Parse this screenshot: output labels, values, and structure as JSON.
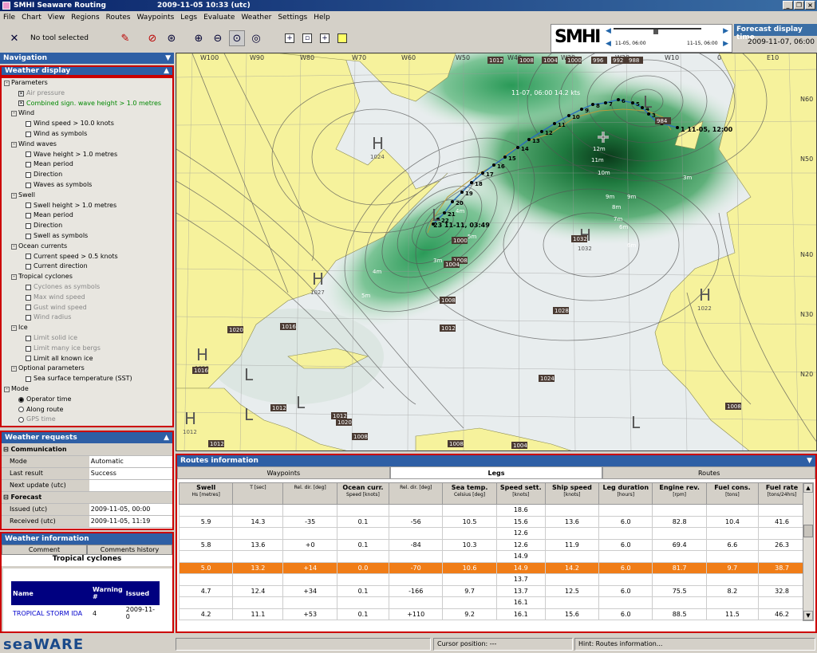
{
  "window": {
    "title": "SMHI Seaware Routing",
    "datetime": "2009-11-05   10:33 (utc)"
  },
  "menu": [
    "File",
    "Chart",
    "View",
    "Regions",
    "Routes",
    "Waypoints",
    "Legs",
    "Evaluate",
    "Weather",
    "Settings",
    "Help"
  ],
  "toolbar": {
    "tool_label": "No tool selected"
  },
  "smhi": {
    "logo": "SMHI",
    "t_left": "11-05, 06:00",
    "t_right": "11-15, 06:00"
  },
  "forecast": {
    "header": "Forecast display time",
    "value": "2009-11-07, 06:00"
  },
  "navigation": {
    "label": "Navigation"
  },
  "weather_display": {
    "label": "Weather display",
    "items": [
      {
        "t": "Parameters",
        "lvl": 0,
        "ex": "-"
      },
      {
        "t": "Air pressure",
        "lvl": 2,
        "cb": "x",
        "cls": "gray"
      },
      {
        "t": "Combined sign. wave height > 1.0 metres",
        "lvl": 2,
        "cb": "x",
        "cls": "green"
      },
      {
        "t": "Wind",
        "lvl": 1,
        "ex": "-"
      },
      {
        "t": "Wind speed > 10.0 knots",
        "lvl": 3,
        "cb": " "
      },
      {
        "t": "Wind as symbols",
        "lvl": 3,
        "cb": " "
      },
      {
        "t": "Wind waves",
        "lvl": 1,
        "ex": "-"
      },
      {
        "t": "Wave height > 1.0 metres",
        "lvl": 3,
        "cb": " "
      },
      {
        "t": "Mean period",
        "lvl": 3,
        "cb": " "
      },
      {
        "t": "Direction",
        "lvl": 3,
        "cb": " "
      },
      {
        "t": "Waves as symbols",
        "lvl": 3,
        "cb": " "
      },
      {
        "t": "Swell",
        "lvl": 1,
        "ex": "-"
      },
      {
        "t": "Swell height > 1.0 metres",
        "lvl": 3,
        "cb": " "
      },
      {
        "t": "Mean period",
        "lvl": 3,
        "cb": " "
      },
      {
        "t": "Direction",
        "lvl": 3,
        "cb": " "
      },
      {
        "t": "Swell as symbols",
        "lvl": 3,
        "cb": " "
      },
      {
        "t": "Ocean currents",
        "lvl": 1,
        "ex": "-"
      },
      {
        "t": "Current speed > 0.5 knots",
        "lvl": 3,
        "cb": " "
      },
      {
        "t": "Current direction",
        "lvl": 3,
        "cb": " "
      },
      {
        "t": "Tropical cyclones",
        "lvl": 1,
        "ex": "-"
      },
      {
        "t": "Cyclones as symbols",
        "lvl": 3,
        "cb": " ",
        "cls": "gray"
      },
      {
        "t": "Max wind speed",
        "lvl": 3,
        "cb": " ",
        "cls": "gray"
      },
      {
        "t": "Gust wind speed",
        "lvl": 3,
        "cb": " ",
        "cls": "gray"
      },
      {
        "t": "Wind radius",
        "lvl": 3,
        "cb": " ",
        "cls": "gray"
      },
      {
        "t": "Ice",
        "lvl": 1,
        "ex": "-"
      },
      {
        "t": "Limit solid ice",
        "lvl": 3,
        "cb": " ",
        "cls": "gray"
      },
      {
        "t": "Limit many ice bergs",
        "lvl": 3,
        "cb": " ",
        "cls": "gray"
      },
      {
        "t": "Limit all known ice",
        "lvl": 3,
        "cb": " "
      },
      {
        "t": "Optional parameters",
        "lvl": 1,
        "ex": "-"
      },
      {
        "t": "Sea surface temperature (SST)",
        "lvl": 3,
        "cb": " "
      },
      {
        "t": "Mode",
        "lvl": 0,
        "ex": "-"
      },
      {
        "t": "Operator time",
        "lvl": 2,
        "rb": "on"
      },
      {
        "t": "Along route",
        "lvl": 2,
        "rb": "off"
      },
      {
        "t": "GPS time",
        "lvl": 2,
        "rb": "off",
        "cls": "gray"
      }
    ]
  },
  "weather_requests": {
    "label": "Weather requests",
    "rows": [
      {
        "g": "Communication"
      },
      {
        "k": "Mode",
        "v": "Automatic"
      },
      {
        "k": "Last result",
        "v": "Success"
      },
      {
        "k": "Next update (utc)",
        "v": ""
      },
      {
        "g": "Forecast"
      },
      {
        "k": "Issued (utc)",
        "v": "2009-11-05, 00:00"
      },
      {
        "k": "Received (utc)",
        "v": "2009-11-05, 11:19"
      }
    ]
  },
  "weather_information": {
    "label": "Weather information",
    "tab_comment": "Comment",
    "tab_history": "Comments history",
    "title": "Tropical cyclones",
    "col_name": "Name",
    "col_warning": "Warning #",
    "col_issued": "Issued",
    "row_name": "TROPICAL STORM IDA",
    "row_warning": "4",
    "row_issued": "2009-11-0"
  },
  "map": {
    "lon_labels": [
      "W100",
      "W90",
      "W80",
      "W70",
      "W60",
      "W50",
      "W40",
      "W30",
      "W20",
      "W10",
      "0",
      "E10"
    ],
    "lat_labels": [
      "N60",
      "N50",
      "N40",
      "N30",
      "N20"
    ],
    "high_labels": [
      {
        "t": "H",
        "v": "1024"
      },
      {
        "t": "H",
        "v": "1032"
      },
      {
        "t": "H",
        "v": "1027"
      },
      {
        "t": "H",
        "v": "1020"
      },
      {
        "t": "H",
        "v": "1022"
      },
      {
        "t": "H",
        "v": "1012"
      }
    ],
    "low_labels": [
      "L",
      "L",
      "L",
      "L",
      "L",
      "L"
    ],
    "isobar_boxes": [
      "1012",
      "1008",
      "1004",
      "1000",
      "996",
      "992",
      "988",
      "984",
      "1008",
      "1000",
      "1004",
      "1008",
      "1012",
      "1016",
      "1020",
      "1024",
      "1028",
      "1032",
      "1008",
      "1012",
      "1016",
      "1020",
      "1012",
      "1008",
      "1004",
      "1012",
      "1008"
    ],
    "wave_labels": [
      "12m",
      "11m",
      "10m",
      "9m",
      "9m",
      "8m",
      "7m",
      "6m",
      "5m",
      "4m",
      "3m",
      "4m",
      "5m",
      "6m",
      "3m"
    ],
    "route_label_start": "1  11-05, 12:00",
    "route_label_end": "23  11-11, 03:49",
    "route_label_now": "11-07, 06:00  14.2 kts",
    "waypoints": [
      "2",
      "3",
      "4",
      "5",
      "6",
      "7",
      "8",
      "9",
      "10",
      "11",
      "12",
      "13",
      "14",
      "15",
      "16",
      "17",
      "18",
      "19",
      "20",
      "21",
      "22"
    ]
  },
  "routes": {
    "label": "Routes information",
    "tab_waypoints": "Waypoints",
    "tab_legs": "Legs",
    "tab_routes": "Routes",
    "columns": [
      {
        "t": "Swell",
        "s": "Hs [metres]"
      },
      {
        "t": "",
        "s": "T [sec]"
      },
      {
        "t": "",
        "s": "Rel. dir. [deg]"
      },
      {
        "t": "Ocean curr.",
        "s": "Speed [knots]"
      },
      {
        "t": "",
        "s": "Rel. dir. [deg]"
      },
      {
        "t": "Sea temp.",
        "s": "Celsius [deg]"
      },
      {
        "t": "Speed sett.",
        "s": "[knots]"
      },
      {
        "t": "Ship speed",
        "s": "[knots]"
      },
      {
        "t": "Leg duration",
        "s": "[hours]"
      },
      {
        "t": "Engine rev.",
        "s": "[rpm]"
      },
      {
        "t": "Fuel cons.",
        "s": "[tons]"
      },
      {
        "t": "Fuel rate",
        "s": "[tons/24hrs]"
      }
    ],
    "rows": [
      [
        "",
        "",
        "",
        "",
        "",
        "",
        "18.6",
        "",
        "",
        "",
        "",
        ""
      ],
      [
        "5.9",
        "14.3",
        "-35",
        "0.1",
        "-56",
        "10.5",
        "15.6",
        "13.6",
        "6.0",
        "82.8",
        "10.4",
        "41.6"
      ],
      [
        "",
        "",
        "",
        "",
        "",
        "",
        "12.6",
        "",
        "",
        "",
        "",
        ""
      ],
      [
        "5.8",
        "13.6",
        "+0",
        "0.1",
        "-84",
        "10.3",
        "12.6",
        "11.9",
        "6.0",
        "69.4",
        "6.6",
        "26.3"
      ],
      [
        "",
        "",
        "",
        "",
        "",
        "",
        "14.9",
        "",
        "",
        "",
        "",
        ""
      ],
      [
        "5.0",
        "13.2",
        "+14",
        "0.0",
        "-70",
        "10.6",
        "14.9",
        "14.2",
        "6.0",
        "81.7",
        "9.7",
        "38.7"
      ],
      [
        "",
        "",
        "",
        "",
        "",
        "",
        "13.7",
        "",
        "",
        "",
        "",
        ""
      ],
      [
        "4.7",
        "12.4",
        "+34",
        "0.1",
        "-166",
        "9.7",
        "13.7",
        "12.5",
        "6.0",
        "75.5",
        "8.2",
        "32.8"
      ],
      [
        "",
        "",
        "",
        "",
        "",
        "",
        "16.1",
        "",
        "",
        "",
        "",
        ""
      ],
      [
        "4.2",
        "11.1",
        "+53",
        "0.1",
        "+110",
        "9.2",
        "16.1",
        "15.6",
        "6.0",
        "88.5",
        "11.5",
        "46.2"
      ]
    ],
    "highlight_row": 5
  },
  "status": {
    "brand": "seaWARE",
    "cursor": "Cursor position:   ---",
    "hint": "Hint: Routes information..."
  }
}
